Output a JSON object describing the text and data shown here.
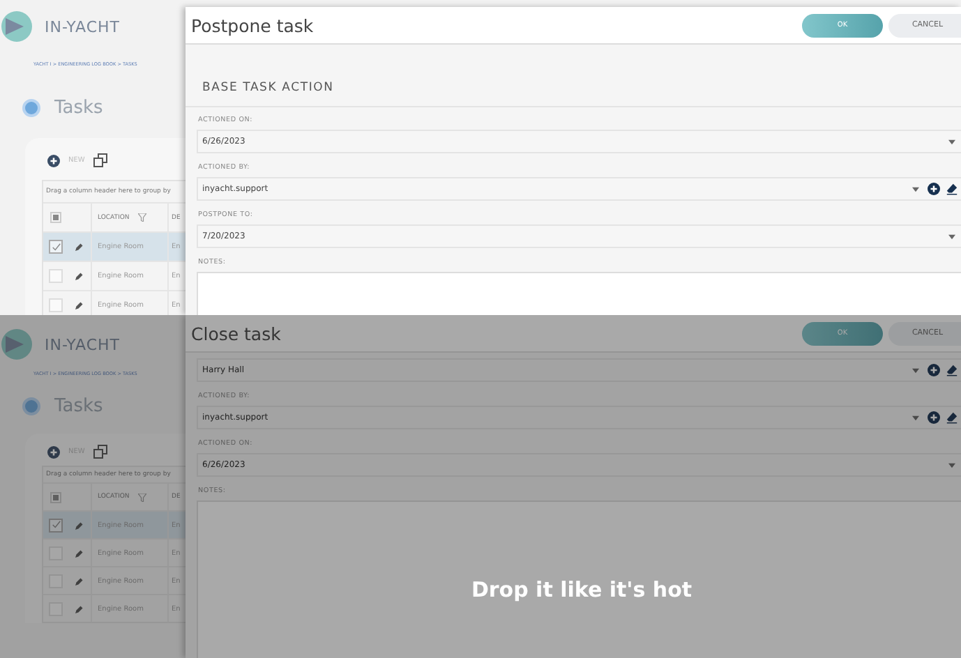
{
  "screens": [
    {
      "app": {
        "logo": "IN-YACHT",
        "breadcrumb": "YACHT I > ENGINEERING LOG BOOK > TASKS",
        "page_title": "Tasks",
        "new_label": "NEW",
        "group_hint": "Drag a column header here to group by",
        "select_all_partial": true,
        "columns": [
          "LOCATION",
          "DE"
        ],
        "rows": [
          {
            "selected": true,
            "location": "Engine Room",
            "column_3": "En"
          },
          {
            "selected": false,
            "location": "Engine Room",
            "column_3": "En"
          },
          {
            "selected": false,
            "location": "Engine Room",
            "column_3": "En"
          }
        ]
      },
      "dialog": {
        "title": "Postpone task",
        "ok": "OK",
        "cancel": "CANCEL",
        "section_title": "BASE TASK ACTION",
        "fields": [
          {
            "kind": "date",
            "label": "ACTIONED ON:",
            "value": "6/26/2023"
          },
          {
            "kind": "lookup",
            "label": "ACTIONED BY:",
            "value": "inyacht.support"
          },
          {
            "kind": "date",
            "label": "POSTPONE TO:",
            "value": "7/20/2023"
          },
          {
            "kind": "notes",
            "label": "NOTES:"
          }
        ]
      }
    },
    {
      "app": {
        "logo": "IN-YACHT",
        "breadcrumb": "YACHT I > ENGINEERING LOG BOOK > TASKS",
        "page_title": "Tasks",
        "new_label": "NEW",
        "group_hint": "Drag a column header here to group by",
        "select_all_partial": true,
        "columns": [
          "LOCATION",
          "DE"
        ],
        "rows": [
          {
            "selected": true,
            "location": "Engine Room",
            "column_3": "En"
          },
          {
            "selected": false,
            "location": "Engine Room",
            "column_3": "En"
          },
          {
            "selected": false,
            "location": "Engine Room",
            "column_3": "En"
          },
          {
            "selected": false,
            "location": "Engine Room",
            "column_3": "En"
          }
        ]
      },
      "dialog": {
        "title": "Close task",
        "ok": "OK",
        "cancel": "CANCEL",
        "fields": [
          {
            "kind": "lookup",
            "value": "Harry Hall"
          },
          {
            "kind": "lookup",
            "label": "ACTIONED BY:",
            "value": "inyacht.support"
          },
          {
            "kind": "date",
            "label": "ACTIONED ON:",
            "value": "6/26/2023"
          },
          {
            "kind": "notes",
            "label": "NOTES:"
          }
        ]
      },
      "overlay_text": "Drop it like it's hot"
    }
  ]
}
